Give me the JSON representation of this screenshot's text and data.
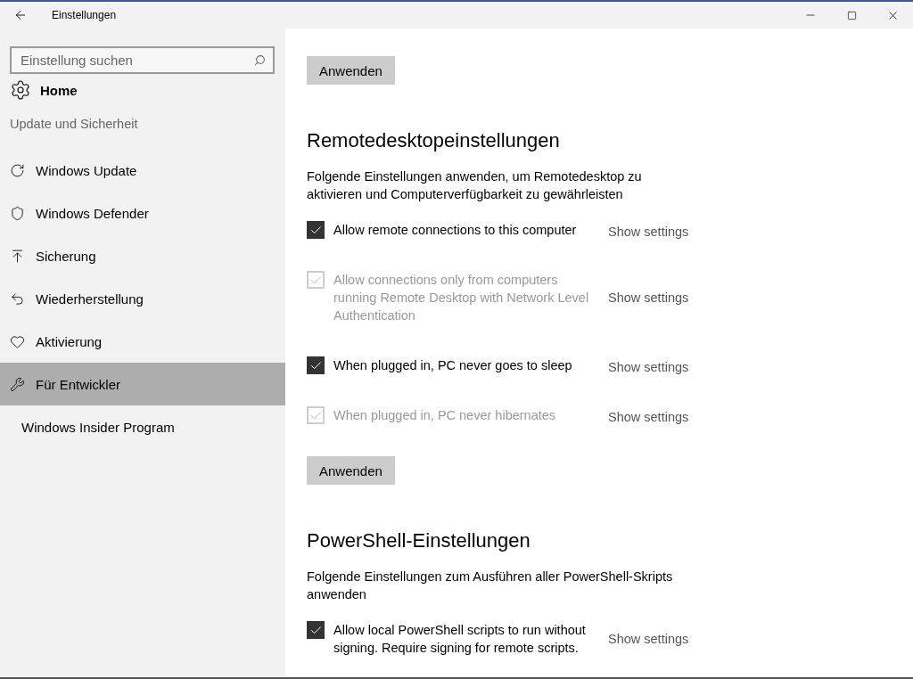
{
  "window": {
    "title": "Einstellungen"
  },
  "sidebar": {
    "search": {
      "placeholder": "Einstellung suchen"
    },
    "home": "Home",
    "section": "Update und Sicherheit",
    "items": [
      {
        "label": "Windows Update",
        "selected": false
      },
      {
        "label": "Windows Defender",
        "selected": false
      },
      {
        "label": "Sicherung",
        "selected": false
      },
      {
        "label": "Wiederherstellung",
        "selected": false
      },
      {
        "label": "Aktivierung",
        "selected": false
      },
      {
        "label": "Für Entwickler",
        "selected": true
      },
      {
        "label": "Windows Insider Program",
        "selected": false
      }
    ]
  },
  "content": {
    "top_button": "Anwenden",
    "sections": [
      {
        "heading": "Remotedesktopeinstellungen",
        "description": "Folgende Einstellungen anwenden, um Remotedesktop zu aktivieren und Computerverfügbarkeit zu gewährleisten",
        "options": [
          {
            "label": "Allow remote connections to this computer",
            "checked": true,
            "disabled": false,
            "link": "Show settings"
          },
          {
            "label": "Allow connections only from computers running Remote Desktop with Network Level Authentication",
            "checked": true,
            "disabled": true,
            "link": "Show settings"
          },
          {
            "label": "When plugged in, PC never goes to sleep",
            "checked": true,
            "disabled": false,
            "link": "Show settings"
          },
          {
            "label": "When plugged in, PC never hibernates",
            "checked": true,
            "disabled": true,
            "link": "Show settings"
          }
        ],
        "button": "Anwenden"
      },
      {
        "heading": "PowerShell-Einstellungen",
        "description": "Folgende Einstellungen zum Ausführen aller PowerShell-Skripts anwenden",
        "options": [
          {
            "label": "Allow local PowerShell scripts to run without signing. Require signing for remote scripts.",
            "checked": true,
            "disabled": false,
            "link": "Show settings"
          }
        ]
      }
    ]
  }
}
